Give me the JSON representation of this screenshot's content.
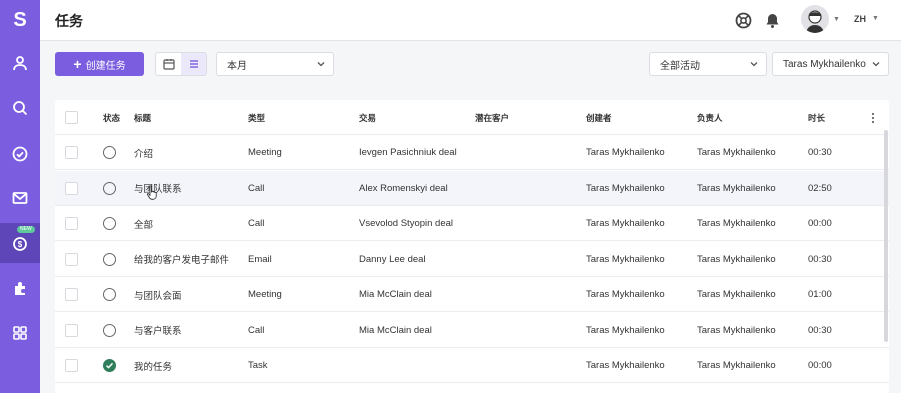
{
  "app": {
    "logo": "S",
    "page_title": "任务",
    "nav_badge": "NEW"
  },
  "header": {
    "lang": "ZH",
    "icons": [
      "support-icon",
      "bell-icon",
      "user-avatar"
    ]
  },
  "toolbar": {
    "create_label": "创建任务",
    "period_select": "本月",
    "activity_select": "全部活动",
    "owner_select": "Taras Mykhailenko"
  },
  "table": {
    "columns": {
      "status": "状态",
      "title": "标题",
      "type": "类型",
      "deal": "交易",
      "lead": "潜在客户",
      "creator": "创建者",
      "assignee": "负责人",
      "duration": "时长"
    },
    "rows": [
      {
        "title": "介绍",
        "type": "Meeting",
        "deal": "Ievgen Pasichniuk deal",
        "lead": "",
        "creator": "Taras Mykhailenko",
        "assignee": "Taras Mykhailenko",
        "duration": "00:30",
        "done": false
      },
      {
        "title": "与团队联系",
        "type": "Call",
        "deal": "Alex Romenskyi deal",
        "lead": "",
        "creator": "Taras Mykhailenko",
        "assignee": "Taras Mykhailenko",
        "duration": "02:50",
        "done": false
      },
      {
        "title": "全部",
        "type": "Call",
        "deal": "Vsevolod Styopin deal",
        "lead": "",
        "creator": "Taras Mykhailenko",
        "assignee": "Taras Mykhailenko",
        "duration": "00:00",
        "done": false
      },
      {
        "title": "给我的客户发电子邮件",
        "type": "Email",
        "deal": "Danny Lee deal",
        "lead": "",
        "creator": "Taras Mykhailenko",
        "assignee": "Taras Mykhailenko",
        "duration": "00:30",
        "done": false
      },
      {
        "title": "与团队会面",
        "type": "Meeting",
        "deal": "Mia McClain deal",
        "lead": "",
        "creator": "Taras Mykhailenko",
        "assignee": "Taras Mykhailenko",
        "duration": "01:00",
        "done": false
      },
      {
        "title": "与客户联系",
        "type": "Call",
        "deal": "Mia McClain deal",
        "lead": "",
        "creator": "Taras Mykhailenko",
        "assignee": "Taras Mykhailenko",
        "duration": "00:30",
        "done": false
      },
      {
        "title": "我的任务",
        "type": "Task",
        "deal": "",
        "lead": "",
        "creator": "Taras Mykhailenko",
        "assignee": "Taras Mykhailenko",
        "duration": "00:00",
        "done": true
      }
    ]
  },
  "colors": {
    "brand": "#7b5ee0",
    "sidebar_active": "#5e45b8",
    "done": "#2e7d5b",
    "notify_dot": "#3cc3b6"
  }
}
